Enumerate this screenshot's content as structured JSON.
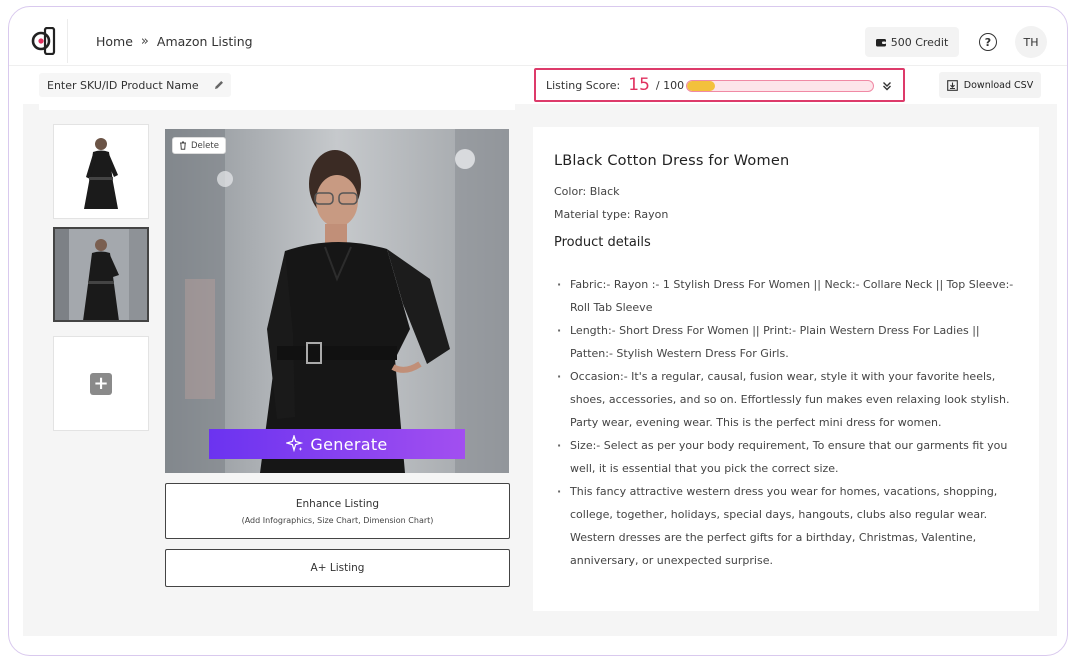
{
  "breadcrumb": {
    "home": "Home",
    "separator": "»",
    "current": "Amazon Listing"
  },
  "header": {
    "credit_label": "500 Credit",
    "help_symbol": "?",
    "avatar_initials": "TH"
  },
  "toolbar": {
    "sku_placeholder": "Enter SKU/ID Product Name",
    "score_label": "Listing Score:",
    "score_value": "15",
    "score_total": "/ 100",
    "score_fraction": 0.15,
    "download_label": "Download CSV"
  },
  "image_panel": {
    "delete_label": "Delete",
    "generate_label": "Generate",
    "enhance_title": "Enhance Listing",
    "enhance_subtitle": "(Add Infographics, Size Chart, Dimension Chart)",
    "aplus_label": "A+ Listing"
  },
  "product": {
    "title": "LBlack Cotton Dress for Women",
    "color": "Color: Black",
    "material": "Material type: Rayon",
    "details_heading": "Product details",
    "bullets": [
      "Fabric:- Rayon :- 1 Stylish Dress For Women || Neck:- Collare Neck || Top Sleeve:- Roll Tab Sleeve",
      "Length:- Short Dress For Women || Print:- Plain Western Dress For Ladies || Patten:- Stylish Western Dress For Girls.",
      "Occasion:- It's a regular, causal, fusion wear, style it with your favorite heels, shoes, accessories, and so on. Effortlessly fun makes even relaxing look stylish. Party wear, evening wear. This is the perfect mini dress for women.",
      "Size:- Select as per your body requirement, To ensure that our garments fit you well, it is essential that you pick the correct size.",
      "This fancy attractive western dress you wear for homes, vacations, shopping, college, together, holidays, special days, hangouts, clubs also regular wear. Western dresses are the perfect gifts for a birthday, Christmas, Valentine, anniversary, or unexpected surprise."
    ]
  },
  "colors": {
    "accent": "#e0315f",
    "generate_start": "#6b33f0",
    "generate_end": "#a24ff0",
    "score_fill": "#f3c13c"
  }
}
